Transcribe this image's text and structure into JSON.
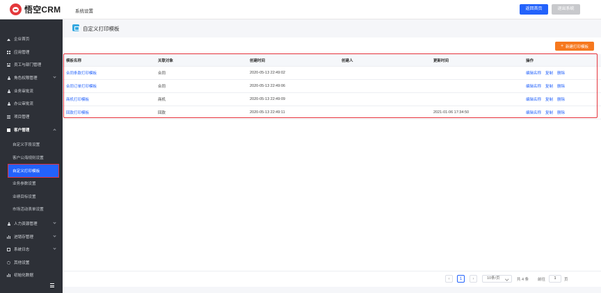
{
  "header": {
    "logo_text": "悟空CRM",
    "system_title": "系统设置",
    "home_button": "返回首页",
    "exit_button": "退出系统"
  },
  "sidebar": {
    "items": [
      {
        "label": "企业首页",
        "icon": "home-icon"
      },
      {
        "label": "应用管理",
        "icon": "grid-icon"
      },
      {
        "label": "员工与部门管理",
        "icon": "users-icon"
      },
      {
        "label": "角色权限管理",
        "icon": "user-icon"
      },
      {
        "label": "业务审批流",
        "icon": "user-icon"
      },
      {
        "label": "办公审批流",
        "icon": "user-icon"
      },
      {
        "label": "项目管理",
        "icon": "list-icon"
      },
      {
        "label": "客户管理",
        "icon": "doc-icon"
      }
    ],
    "sub_items": [
      {
        "label": "自定义字段设置"
      },
      {
        "label": "客户公海规则设置"
      },
      {
        "label": "自定义打印模板"
      },
      {
        "label": "业务参数设置"
      },
      {
        "label": "业绩目标设置"
      },
      {
        "label": "市场活动表单设置"
      }
    ],
    "bottom_items": [
      {
        "label": "人力资源管理",
        "icon": "user-icon"
      },
      {
        "label": "进销存管理",
        "icon": "chart-icon"
      },
      {
        "label": "系统日志",
        "icon": "box-icon"
      },
      {
        "label": "其他设置",
        "icon": "gear-icon"
      },
      {
        "label": "初始化数据",
        "icon": "chart-icon"
      }
    ],
    "active_sub": "自定义打印模板"
  },
  "page": {
    "title": "自定义打印模板",
    "new_button": "新建打印模板"
  },
  "table": {
    "headers": [
      "模板名称",
      "关联对象",
      "创建时间",
      "创建人",
      "更新时间",
      "操作"
    ],
    "rows": [
      {
        "name": "合同条款打印模板",
        "object": "合同",
        "created": "2020-05-13 22:49:02",
        "creator": "",
        "updated": ""
      },
      {
        "name": "合同订单打印模板",
        "object": "合同",
        "created": "2020-05-13 22:49:06",
        "creator": "",
        "updated": ""
      },
      {
        "name": "商机打印模板",
        "object": "商机",
        "created": "2020-05-13 22:49:09",
        "creator": "",
        "updated": ""
      },
      {
        "name": "回款打印模板",
        "object": "回款",
        "created": "2020-05-13 22:49:11",
        "creator": "",
        "updated": "2021-01-06 17:34:50"
      }
    ],
    "actions": [
      "编辑名称",
      "复制",
      "删除"
    ]
  },
  "pagination": {
    "current_page": "1",
    "page_size": "10条/页",
    "total": "共 4 条",
    "goto_label": "前往",
    "goto_value": "1",
    "page_unit": "页",
    "prev_icon": "chevron-left-icon",
    "next_icon": "chevron-right-icon"
  },
  "colors": {
    "primary": "#2362fb",
    "orange": "#f6781e",
    "sidebar_bg": "#2d3037",
    "highlight": "#e5313b"
  }
}
